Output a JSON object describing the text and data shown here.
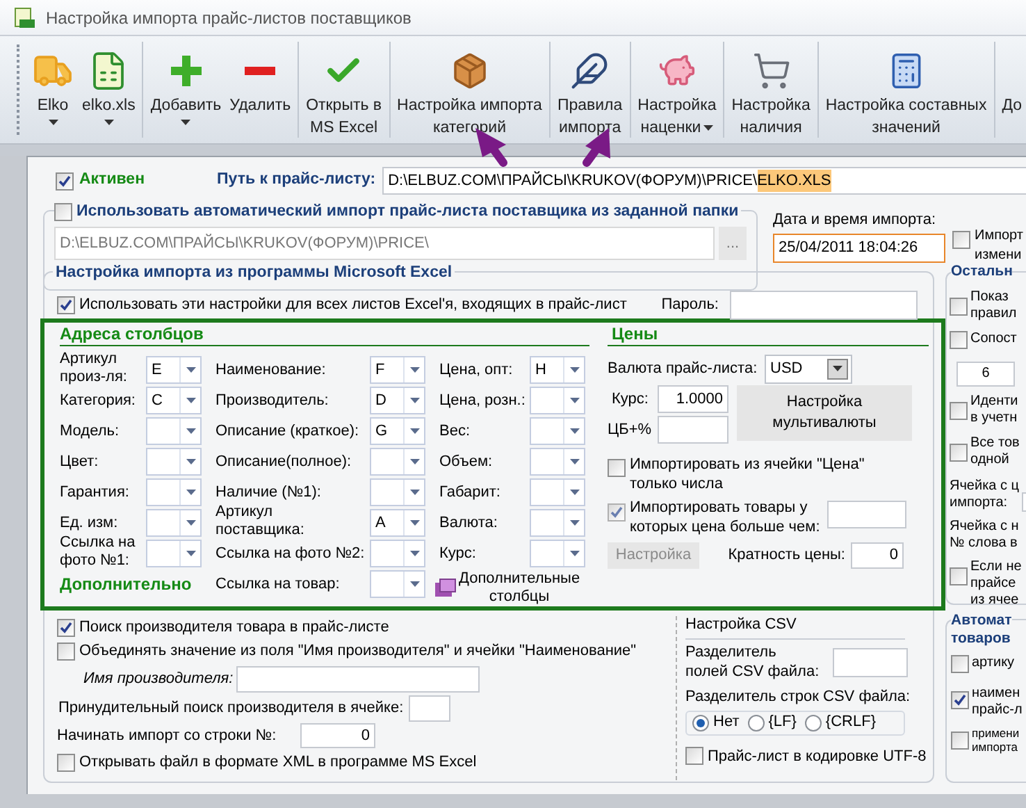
{
  "window": {
    "title": "Настройка импорта прайс-листов поставщиков"
  },
  "toolbar": [
    {
      "lines": [
        "Elko"
      ],
      "dropdown": true,
      "inline_caret": false
    },
    {
      "lines": [
        "elko.xls"
      ],
      "dropdown": true,
      "inline_caret": false
    },
    {
      "lines": [
        "Добавить"
      ],
      "dropdown": true,
      "inline_caret": false
    },
    {
      "lines": [
        "Удалить"
      ],
      "dropdown": false
    },
    {
      "lines": [
        "Открыть в",
        "MS Excel"
      ],
      "dropdown": false
    },
    {
      "lines": [
        "Настройка импорта",
        "категорий"
      ],
      "dropdown": false
    },
    {
      "lines": [
        "Правила",
        "импорта"
      ],
      "dropdown": false
    },
    {
      "lines": [
        "Настройка",
        "наценки"
      ],
      "dropdown": true,
      "inline_caret": true
    },
    {
      "lines": [
        "Настройка",
        "наличия"
      ],
      "dropdown": false
    },
    {
      "lines": [
        "Настройка составных",
        "значений"
      ],
      "dropdown": false
    },
    {
      "lines": [
        "До"
      ],
      "dropdown": false
    }
  ],
  "active": {
    "label": "Активен",
    "checked": true
  },
  "path": {
    "label": "Путь к прайс-листу:",
    "value": "D:\\ELBUZ.COM\\ПРАЙСЫ\\KRUKOV(ФОРУМ)\\PRICE\\",
    "selected_text": "ELKO.XLS"
  },
  "auto_import": {
    "label": "Использовать автоматический импорт прайс-листа поставщика из заданной папки",
    "checked": false,
    "folder": "D:\\ELBUZ.COM\\ПРАЙСЫ\\KRUKOV(ФОРУМ)\\PRICE\\",
    "browse": "..."
  },
  "import_date": {
    "label": "Дата и время импорта:",
    "value": "25/04/2011 18:04:26"
  },
  "import_changed": {
    "lines": [
      "Импорт",
      "измени"
    ],
    "checked": false
  },
  "excel": {
    "title": "Настройка импорта из программы Microsoft Excel",
    "all_sheets": {
      "label": "Использовать эти настройки для всех листов Excel'я, входящих в прайс-лист",
      "checked": true
    },
    "password": {
      "label": "Пароль:"
    }
  },
  "columns": {
    "title": "Адреса столбцов",
    "groups": [
      {
        "fields": [
          {
            "lines": [
              "Артикул",
              "произ-ля:"
            ],
            "value": "E"
          },
          {
            "lines": [
              "Категория:"
            ],
            "value": "C"
          },
          {
            "lines": [
              "Модель:"
            ]
          },
          {
            "lines": [
              "Цвет:"
            ]
          },
          {
            "lines": [
              "Гарантия:"
            ]
          },
          {
            "lines": [
              "Ед. изм:"
            ]
          },
          {
            "lines": [
              "Ссылка на",
              "фото №1:"
            ]
          }
        ]
      },
      {
        "fields": [
          {
            "lines": [
              "Наименование:"
            ],
            "value": "F"
          },
          {
            "lines": [
              "Производитель:"
            ],
            "value": "D"
          },
          {
            "lines": [
              "Описание (краткое):"
            ],
            "value": "G"
          },
          {
            "lines": [
              "Описание(полное):"
            ]
          },
          {
            "lines": [
              "Наличие (№1):"
            ]
          },
          {
            "lines": [
              "Артикул",
              "поставщика:"
            ],
            "value": "A"
          },
          {
            "lines": [
              "Ссылка на фото №2:"
            ]
          },
          {
            "lines": [
              "Ссылка на товар:"
            ]
          }
        ]
      },
      {
        "fields": [
          {
            "lines": [
              "Цена, опт:"
            ],
            "value": "H"
          },
          {
            "lines": [
              "Цена, розн.:"
            ]
          },
          {
            "lines": [
              "Вес:"
            ]
          },
          {
            "lines": [
              "Объем:"
            ]
          },
          {
            "lines": [
              "Габарит:"
            ]
          },
          {
            "lines": [
              "Валюта:"
            ]
          },
          {
            "lines": [
              "Курс:"
            ]
          }
        ]
      }
    ],
    "extra_button": {
      "lines": [
        "Дополнительные",
        "столбцы"
      ]
    }
  },
  "prices": {
    "title": "Цены",
    "currency": {
      "label": "Валюта прайс-листа:",
      "value": "USD"
    },
    "rate": {
      "label": "Курс:",
      "value": "1.0000"
    },
    "cb": {
      "label": "ЦБ+%"
    },
    "multicurrency_button": {
      "lines": [
        "Настройка",
        "мультивалюты"
      ]
    },
    "only_numbers": {
      "lines": [
        "Импортировать из ячейки \"Цена\"",
        "только числа"
      ],
      "checked": false
    },
    "min_price": {
      "lines": [
        "Импортировать товары у",
        "которых цена больше чем:"
      ],
      "checked": true
    },
    "settings_button": {
      "label": "Настройка",
      "disabled": true
    },
    "multiplicity": {
      "label": "Кратность цены:",
      "value": "0"
    }
  },
  "additional": {
    "title": "Дополнительно",
    "search_manufacturer": {
      "label": "Поиск производителя товара в прайс-листе",
      "checked": true
    },
    "merge": {
      "label": "Объединять значение из поля \"Имя производителя\" и ячейки \"Наименование\"",
      "checked": false
    },
    "manufacturer_name": {
      "label": "Имя производителя:"
    },
    "forced_search": {
      "label": "Принудительный поиск производителя в ячейке:"
    },
    "start_row": {
      "label": "Начинать импорт со строки №:",
      "value": "0"
    },
    "open_xml": {
      "label": "Открывать файл в формате XML в программе MS Excel",
      "checked": false
    }
  },
  "csv": {
    "title": "Настройка CSV",
    "field_sep": {
      "lines": [
        "Разделитель",
        "полей CSV файла:"
      ]
    },
    "row_sep": {
      "label": "Разделитель строк CSV файла:",
      "options": [
        {
          "label": "Нет",
          "selected": true
        },
        {
          "label": "{LF}",
          "selected": false
        },
        {
          "label": "{CRLF}",
          "selected": false
        }
      ]
    },
    "utf8": {
      "label": "Прайс-лист в кодировке UTF-8",
      "checked": false
    }
  },
  "other": {
    "title": "Остальн",
    "items": [
      {
        "kind": "checkbox",
        "lines": [
          "Показ",
          "правил"
        ],
        "checked": false
      },
      {
        "kind": "checkbox",
        "lines": [
          "Сопост"
        ],
        "checked": false
      },
      {
        "kind": "field",
        "value": "6"
      },
      {
        "kind": "checkbox",
        "lines": [
          "Иденти",
          "в учетн"
        ],
        "checked": false
      },
      {
        "kind": "checkbox",
        "lines": [
          "Все тов",
          "одной"
        ],
        "checked": false
      },
      {
        "kind": "labeled_field",
        "lines": [
          "Ячейка с ц",
          "импорта:"
        ]
      },
      {
        "kind": "text",
        "lines": [
          "Ячейка с н",
          "№ слова в"
        ]
      },
      {
        "kind": "checkbox",
        "lines": [
          "Если не",
          "прайсе",
          "из ячее"
        ],
        "checked": false
      }
    ]
  },
  "auto": {
    "title_lines": [
      "Автомат",
      "товаров"
    ],
    "items": [
      {
        "kind": "checkbox",
        "lines": [
          "артику"
        ],
        "checked": false
      },
      {
        "kind": "checkbox",
        "lines": [
          "наимен",
          "прайс-л"
        ],
        "checked": true
      },
      {
        "kind": "small_checkbox",
        "lines": [
          "примени",
          "импорта"
        ],
        "checked": false
      }
    ]
  }
}
